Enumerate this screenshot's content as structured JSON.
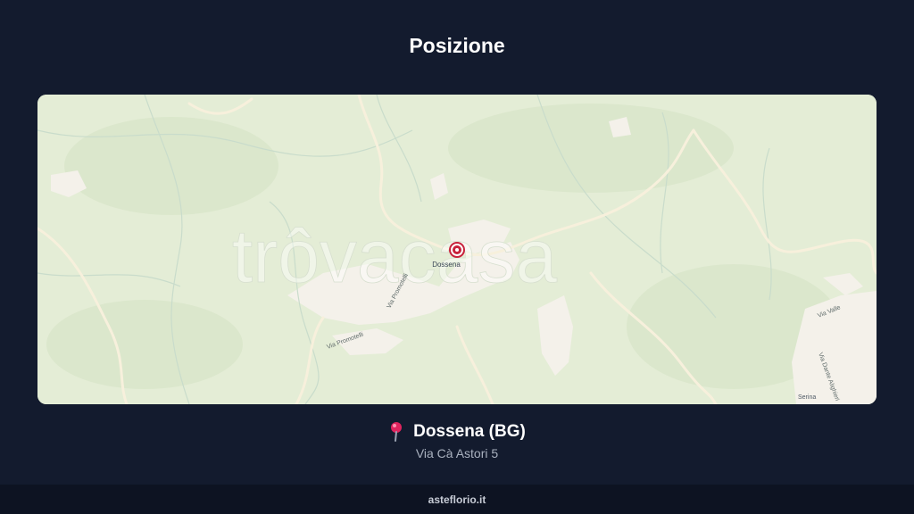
{
  "page": {
    "title": "Posizione"
  },
  "map": {
    "watermark": "trôvacasa",
    "marker_label": "Dossena",
    "street_labels": [
      "Via Promotelli",
      "Via Promotelli",
      "Via Promotelli",
      "Via Valle",
      "Via Dante Alighieri"
    ],
    "town_labels": [
      "Serina"
    ],
    "marker_icon": "map-marker-icon"
  },
  "location": {
    "pin_icon": "round-pushpin-icon",
    "name": "Dossena (BG)",
    "address": "Via Cà Astori 5"
  },
  "footer": {
    "site": "asteflorio.it"
  }
}
